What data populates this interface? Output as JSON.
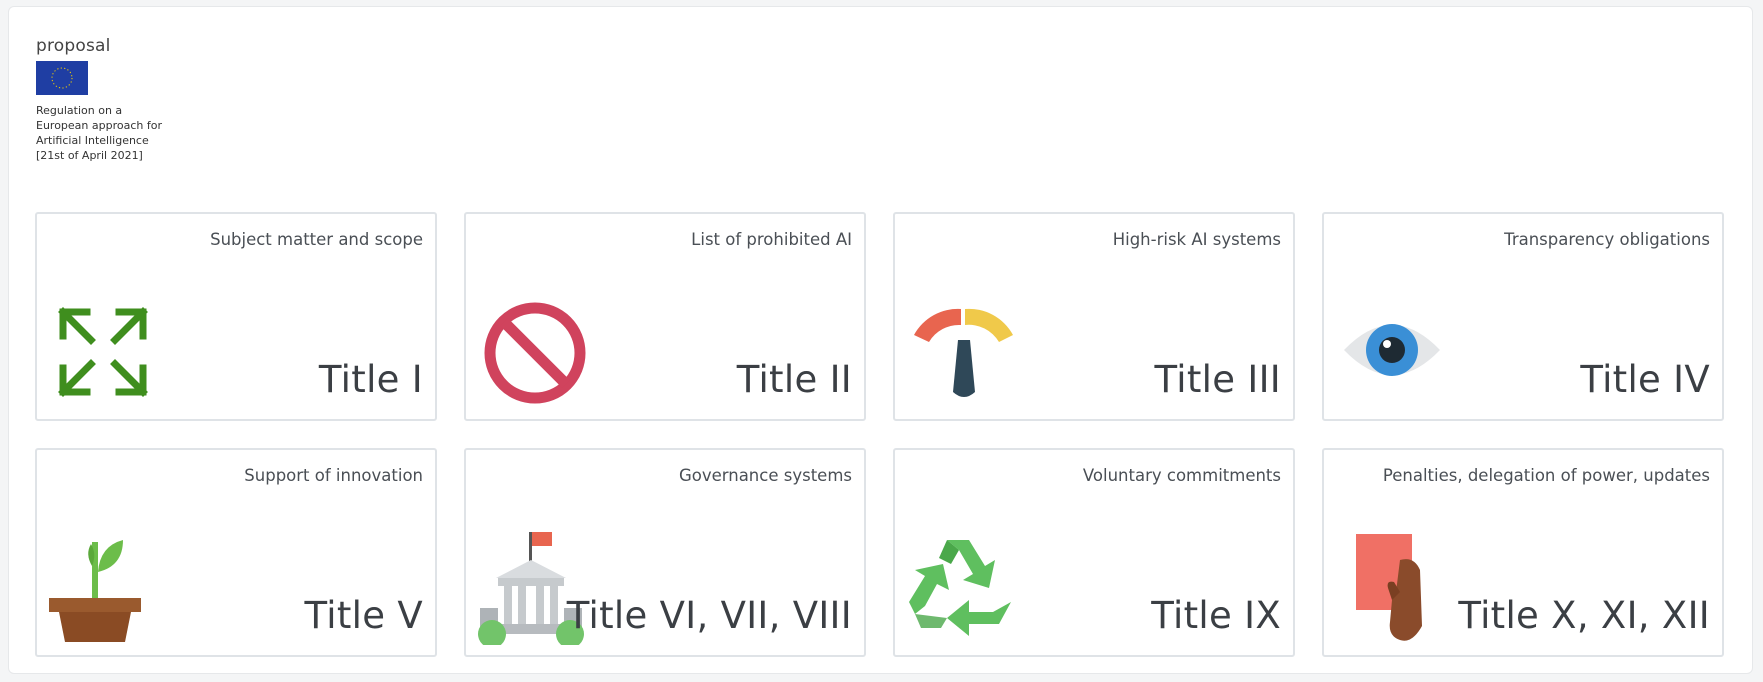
{
  "header": {
    "proposal_label": "proposal",
    "regulation_text": "Regulation on a\nEuropean approach for\nArtificial Intelligence\n[21st of April 2021]"
  },
  "colors": {
    "eu_blue": "#1f3ea3",
    "eu_star": "#f5d000",
    "arrow_green": "#3f8e1e",
    "prohibited_red": "#d0435d",
    "gauge_red": "#e8654f",
    "gauge_yellow": "#f0c94a",
    "gauge_needle": "#2f4858",
    "eye_blue": "#3a8fd6",
    "recycle_green": "#5fbf5f",
    "card_red": "#f07065",
    "hand_brown": "#8a4b2b"
  },
  "cards": [
    {
      "heading": "Subject matter and scope",
      "title": "Title I",
      "icon": "expand-arrows-icon"
    },
    {
      "heading": "List of prohibited AI",
      "title": "Title II",
      "icon": "prohibited-icon"
    },
    {
      "heading": "High-risk AI systems",
      "title": "Title III",
      "icon": "gauge-icon"
    },
    {
      "heading": "Transparency obligations",
      "title": "Title IV",
      "icon": "eye-icon"
    },
    {
      "heading": "Support of innovation",
      "title": "Title V",
      "icon": "seedling-icon"
    },
    {
      "heading": "Governance systems",
      "title": "Title VI, VII, VIII",
      "icon": "government-building-icon"
    },
    {
      "heading": "Voluntary commitments",
      "title": "Title IX",
      "icon": "recycle-icon"
    },
    {
      "heading": "Penalties, delegation of power, updates",
      "title": "Title X, XI, XII",
      "icon": "red-card-icon"
    }
  ]
}
